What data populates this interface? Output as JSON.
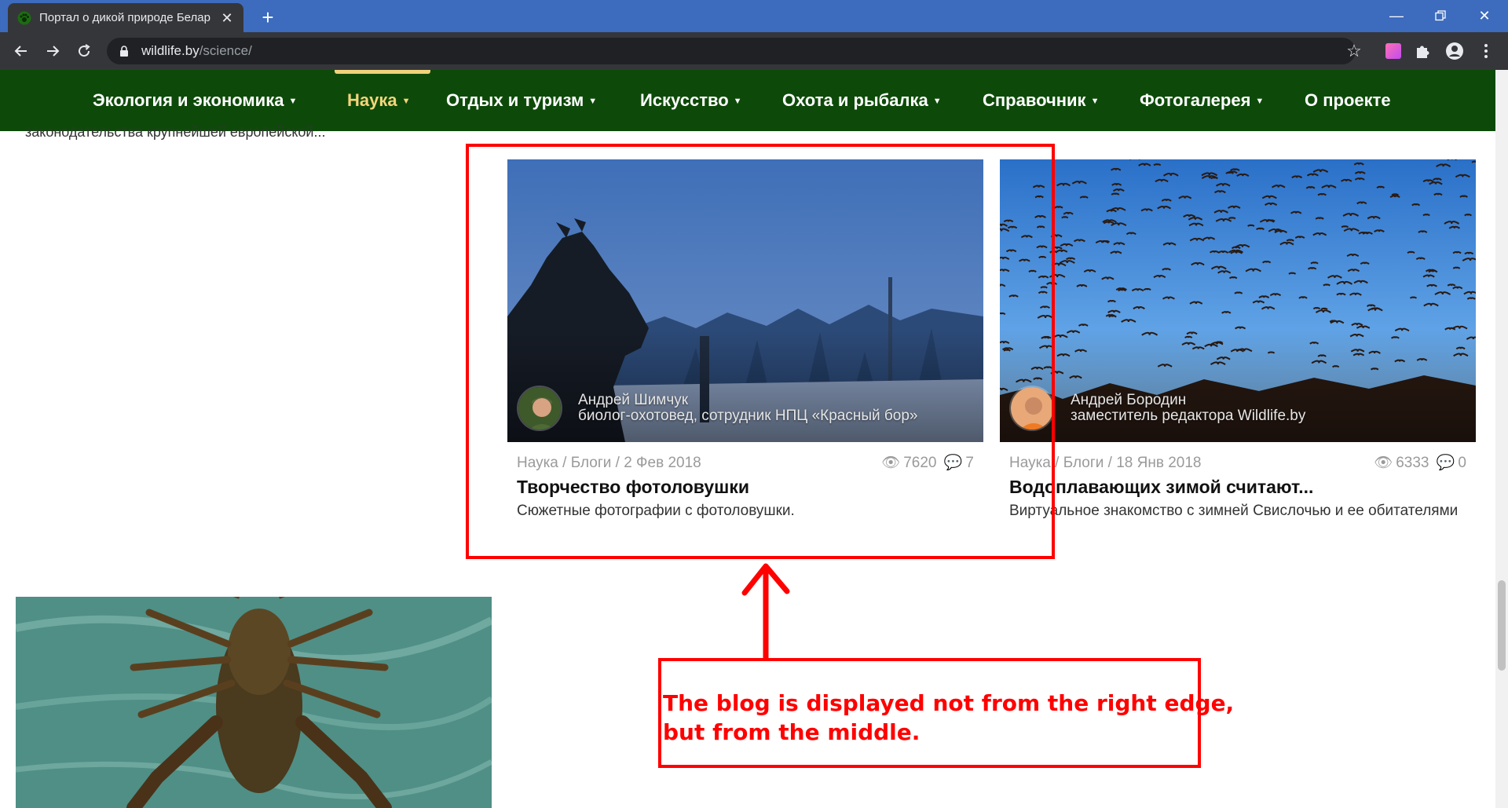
{
  "browser": {
    "tab_title": "Портал о дикой природе Белар",
    "new_tab": "+",
    "url_host": "wildlife.by",
    "url_path": "/science/"
  },
  "nav": {
    "items": [
      {
        "label": "Экология и экономика"
      },
      {
        "label": "Наука"
      },
      {
        "label": "Отдых и туризм"
      },
      {
        "label": "Искусство"
      },
      {
        "label": "Охота и рыбалка"
      },
      {
        "label": "Справочник"
      },
      {
        "label": "Фотогалерея"
      },
      {
        "label": "О проекте"
      }
    ],
    "active": "Наука"
  },
  "content": {
    "cut_text": "законодательства крупнейшей европейской..."
  },
  "cards": [
    {
      "author_name": "Андрей Шимчук",
      "author_role": "биолог-охотовед, сотрудник НПЦ «Красный бор»",
      "meta": "Наука / Блоги / 2 Фев 2018",
      "views": "7620",
      "comments": "7",
      "title": "Творчество фотоловушки",
      "desc": "Сюжетные фотографии с фотоловушки."
    },
    {
      "author_name": "Андрей Бородин",
      "author_role": "заместитель редактора Wildlife.by",
      "meta": "Наука / Блоги / 18 Янв 2018",
      "views": "6333",
      "comments": "0",
      "title": "Водоплавающих зимой считают...",
      "desc": "Виртуальное знакомство с зимней Свислочью и ее обитателями"
    }
  ],
  "annotation": {
    "line1": "The blog is displayed not from the right edge,",
    "line2": "but from the middle.",
    "color": "#ff0000"
  },
  "colors": {
    "nav_bg": "#0d4a09",
    "nav_active": "#f3d57c",
    "tabbar_bg": "#3d6bbd"
  }
}
